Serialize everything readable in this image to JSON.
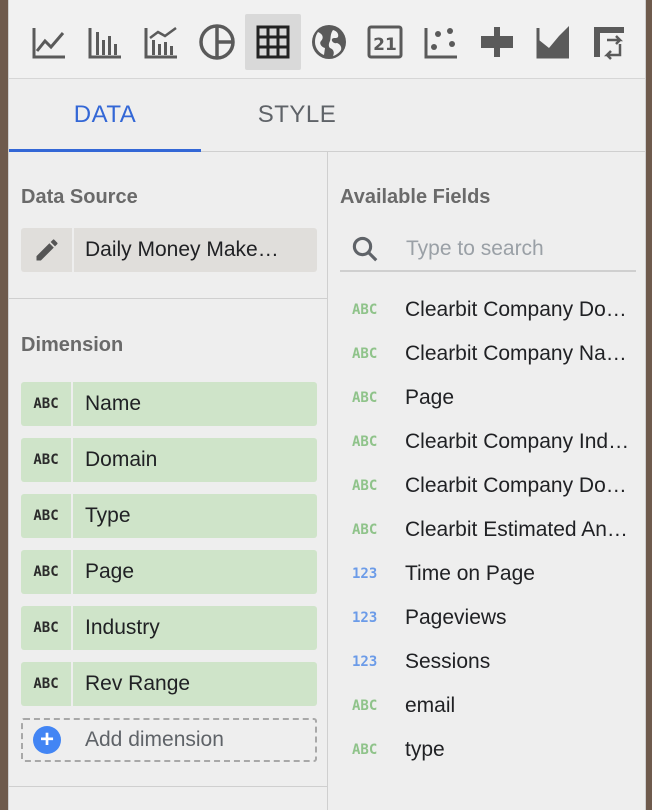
{
  "colors": {
    "accent": "#3367d6",
    "dimension_chip": "#cfe4c9",
    "text_type_green": "#8fc38a",
    "number_type_blue": "#6b9be8",
    "add_button": "#4285f4"
  },
  "toolbar": {
    "chart_types": [
      {
        "icon": "time-series-chart-icon",
        "selected": false
      },
      {
        "icon": "bar-chart-icon",
        "selected": false
      },
      {
        "icon": "combo-chart-icon",
        "selected": false
      },
      {
        "icon": "pie-chart-icon",
        "selected": false
      },
      {
        "icon": "table-chart-icon",
        "selected": true
      },
      {
        "icon": "geo-map-icon",
        "selected": false
      },
      {
        "icon": "scorecard-icon",
        "selected": false,
        "label": "21"
      },
      {
        "icon": "scatter-chart-icon",
        "selected": false
      },
      {
        "icon": "bullet-chart-icon",
        "selected": false
      },
      {
        "icon": "area-chart-icon",
        "selected": false
      },
      {
        "icon": "pivot-table-icon",
        "selected": false
      }
    ]
  },
  "tabs": [
    {
      "label": "DATA",
      "active": true
    },
    {
      "label": "STYLE",
      "active": false
    }
  ],
  "data_source": {
    "title": "Data Source",
    "name": "Daily Money Make…",
    "edit_icon": "pencil-icon"
  },
  "dimension": {
    "title": "Dimension",
    "items": [
      {
        "type": "ABC",
        "name": "Name"
      },
      {
        "type": "ABC",
        "name": "Domain"
      },
      {
        "type": "ABC",
        "name": "Type"
      },
      {
        "type": "ABC",
        "name": "Page"
      },
      {
        "type": "ABC",
        "name": "Industry"
      },
      {
        "type": "ABC",
        "name": "Rev Range"
      }
    ],
    "add_label": "Add dimension"
  },
  "available_fields": {
    "title": "Available Fields",
    "search_placeholder": "Type to search",
    "fields": [
      {
        "type": "ABC",
        "name": "Clearbit Company Do…"
      },
      {
        "type": "ABC",
        "name": "Clearbit Company Na…"
      },
      {
        "type": "ABC",
        "name": "Page"
      },
      {
        "type": "ABC",
        "name": "Clearbit Company Ind…"
      },
      {
        "type": "ABC",
        "name": "Clearbit Company Do…"
      },
      {
        "type": "ABC",
        "name": "Clearbit Estimated An…"
      },
      {
        "type": "123",
        "name": "Time on Page"
      },
      {
        "type": "123",
        "name": "Pageviews"
      },
      {
        "type": "123",
        "name": "Sessions"
      },
      {
        "type": "ABC",
        "name": "email"
      },
      {
        "type": "ABC",
        "name": "type"
      }
    ]
  }
}
